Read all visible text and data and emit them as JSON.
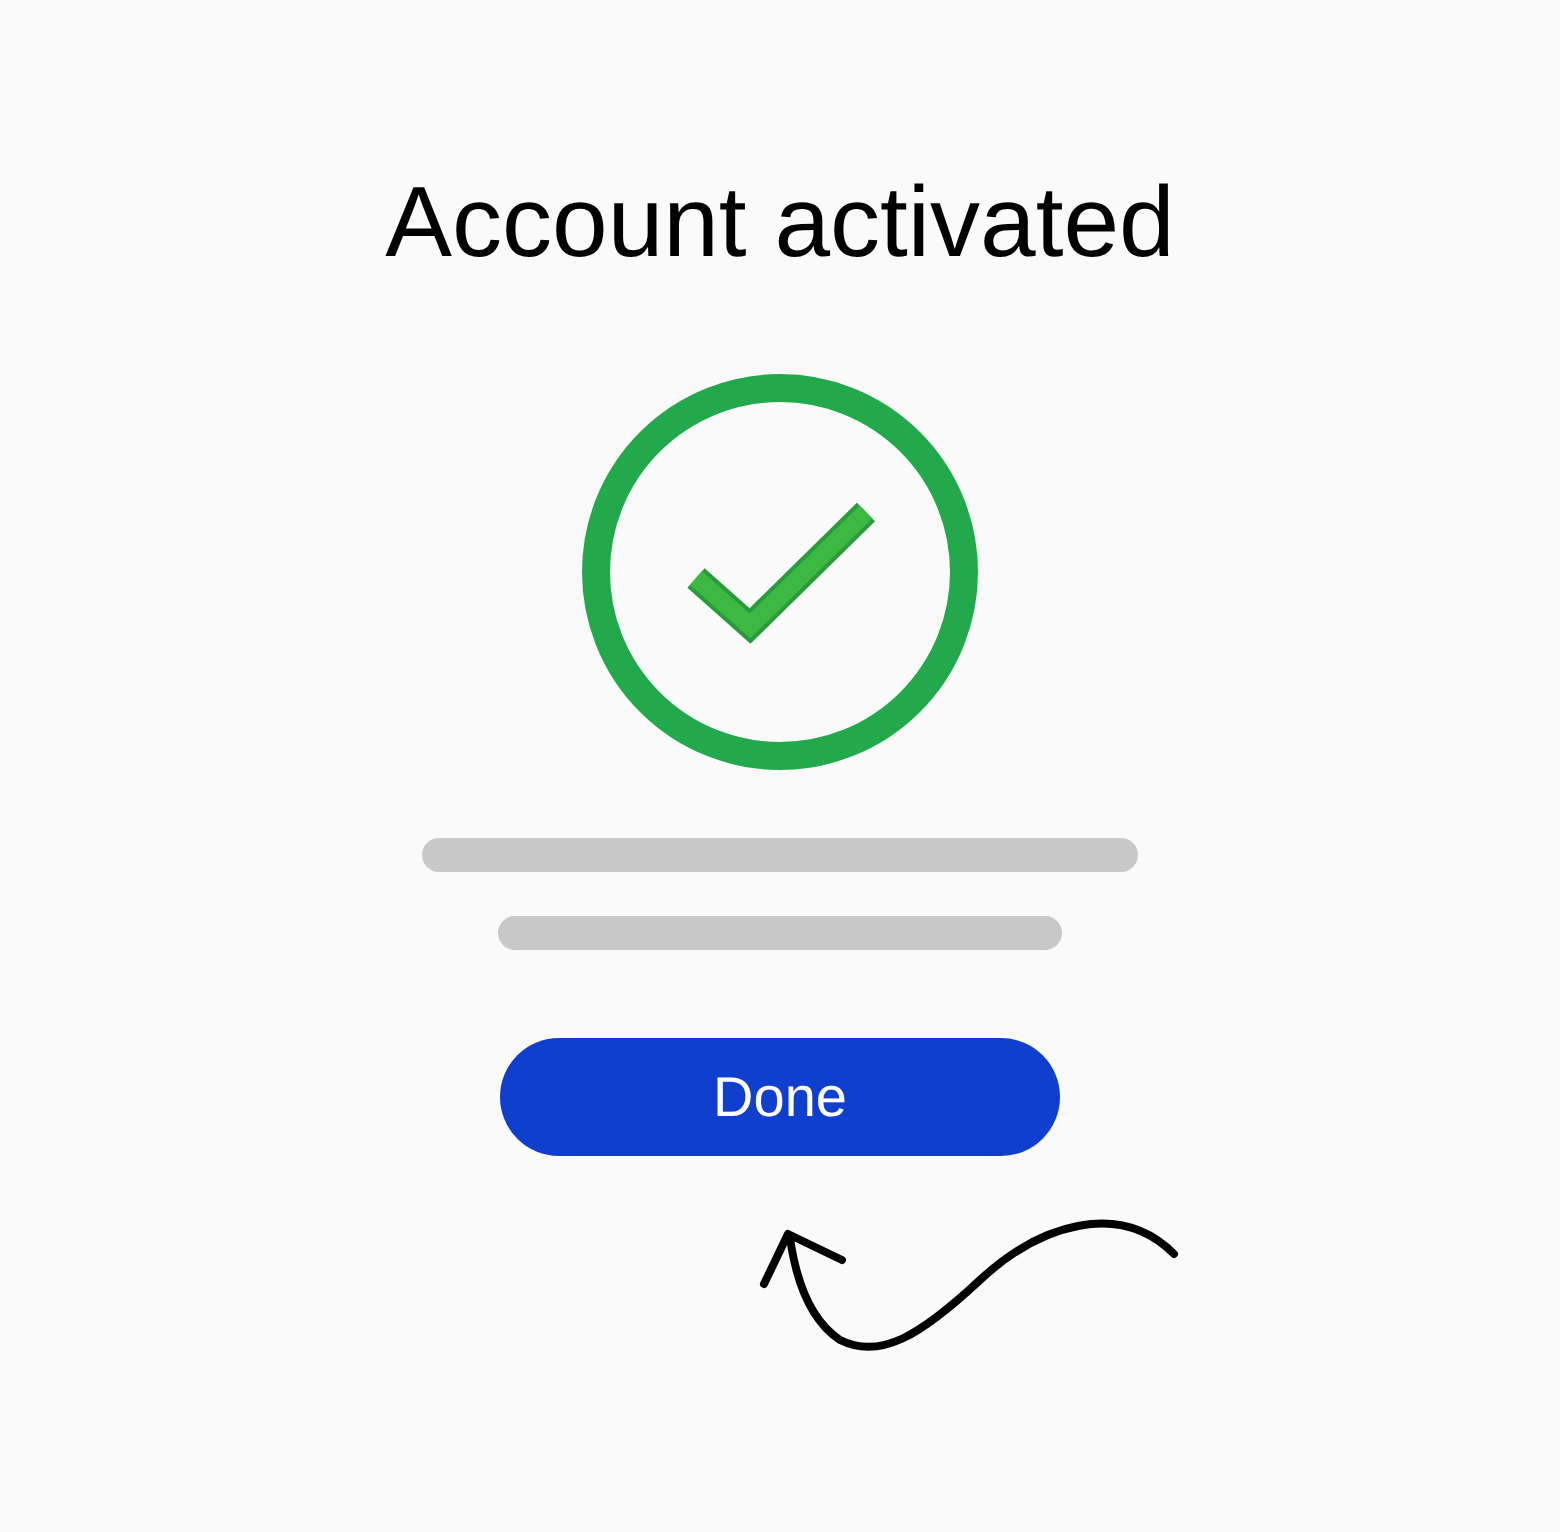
{
  "title": "Account activated",
  "done_button": {
    "label": "Done"
  }
}
